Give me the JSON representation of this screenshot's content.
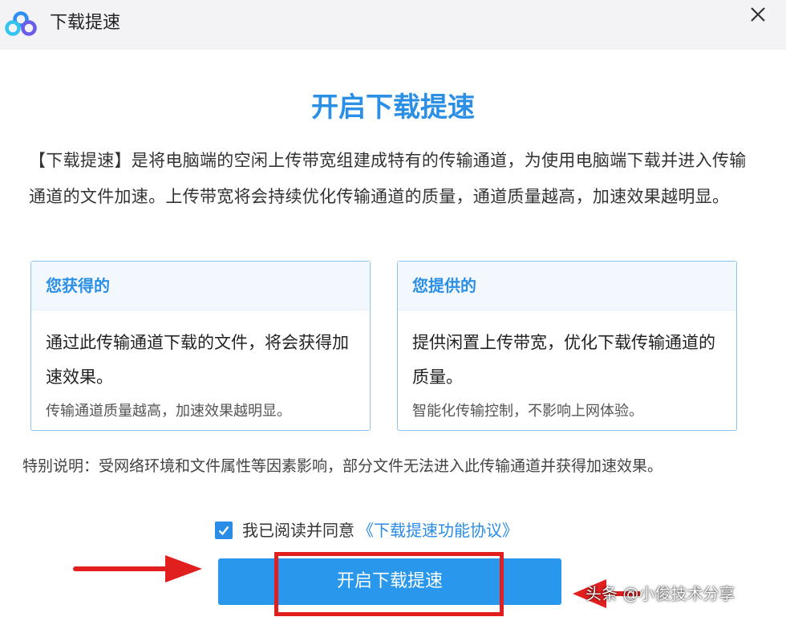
{
  "window": {
    "title": "下载提速",
    "close_icon": "close-icon",
    "logo_icon": "cloud-logo-icon"
  },
  "main": {
    "headline": "开启下载提速",
    "intro": "【下载提速】是将电脑端的空闲上传带宽组建成特有的传输通道，为使用电脑端下载并进入传输通道的文件加速。上传带宽将会持续优化传输通道的质量，通道质量越高，加速效果越明显。"
  },
  "cards": [
    {
      "title": "您获得的",
      "body": "通过此传输通道下载的文件，将会获得加速效果。",
      "note": "传输通道质量越高，加速效果越明显。"
    },
    {
      "title": "您提供的",
      "body": "提供闲置上传带宽，优化下载传输通道的质量。",
      "note": "智能化传输控制，不影响上网体验。"
    }
  ],
  "notice": "特别说明：受网络环境和文件属性等因素影响，部分文件无法进入此传输通道并获得加速效果。",
  "agreement": {
    "checked": true,
    "text": "我已阅读并同意",
    "link": "《下载提速功能协议》"
  },
  "button": {
    "label": "开启下载提速"
  },
  "watermark": "头条 @小俊技术分享",
  "colors": {
    "accent": "#2b8fe6",
    "button": "#2897ec",
    "highlight": "#e11f1f"
  }
}
